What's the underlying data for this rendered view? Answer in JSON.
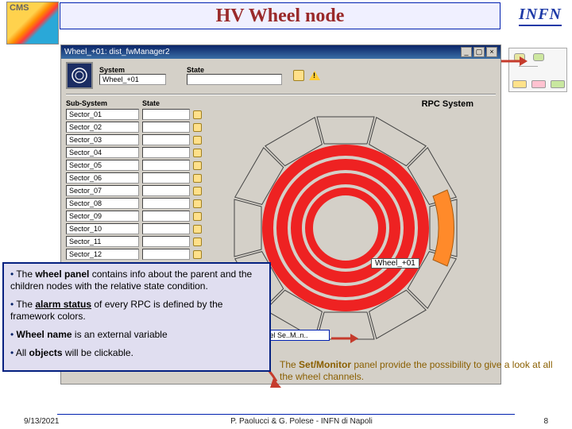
{
  "title": "HV Wheel node",
  "logos": {
    "cms": "cms-logo",
    "infn": "INFN"
  },
  "window": {
    "title": "Wheel_+01: dist_fwManager2",
    "controls": [
      "min",
      "max",
      "close"
    ],
    "system_label": "System",
    "state_label": "State",
    "system_value": "Wheel_+01",
    "state_value": "",
    "sub_label": "Sub-System",
    "sub_state_label": "State",
    "sectors": [
      "Sector_01",
      "Sector_02",
      "Sector_03",
      "Sector_04",
      "Sector_05",
      "Sector_06",
      "Sector_07",
      "Sector_08",
      "Sector_09",
      "Sector_10",
      "Sector_11",
      "Sector_12"
    ],
    "rpc_title": "RPC System",
    "wheel_tag": "Wheel_+01",
    "setmon_label": "Wheel Se..M..n.."
  },
  "overlay": {
    "b0a": "wheel panel",
    "t0a": "The ",
    "t0b": " contains info about the parent and the children nodes with the relative state condition.",
    "b1a": "alarm status",
    "t1a": "The ",
    "t1b": " of every RPC is defined by the framework colors.",
    "b2a": "Wheel name",
    "t2b": " is an external variable",
    "b3a": "objects",
    "t3a": "All ",
    "t3b": " will be clickable."
  },
  "anno_right": {
    "b": "Set/Monitor",
    "pre": "The ",
    "post": " panel provide the possibility to give a look at all the wheel channels."
  },
  "footer": {
    "date": "9/13/2021",
    "author": "P. Paolucci & G. Polese - INFN di Napoli",
    "page": "8"
  }
}
